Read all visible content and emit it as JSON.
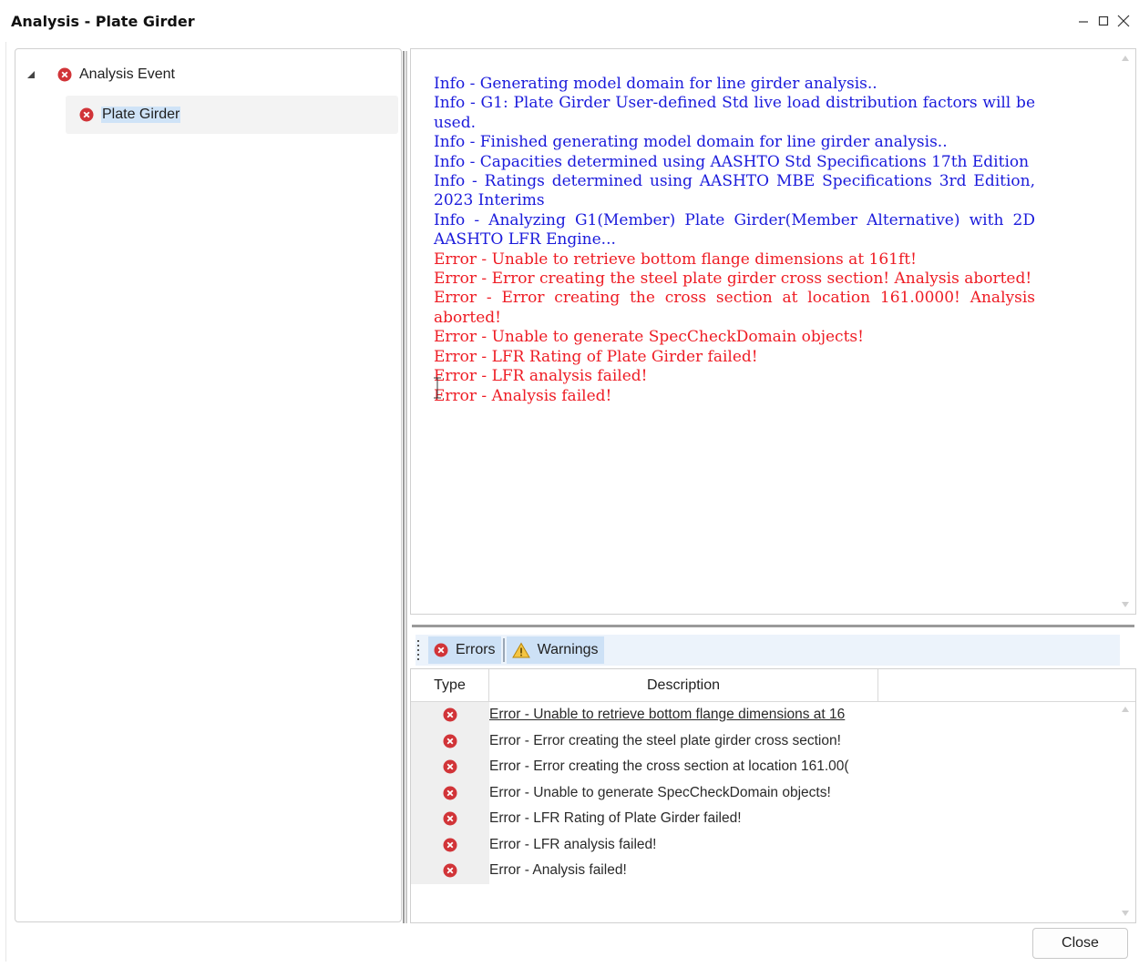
{
  "window": {
    "title": "Analysis - Plate Girder",
    "controls": [
      "minimize",
      "maximize",
      "close"
    ]
  },
  "tree": {
    "root": {
      "label": "Analysis Event",
      "icon": "error-icon",
      "expanded": true
    },
    "children": [
      {
        "label": "Plate Girder",
        "icon": "error-icon",
        "selected": true
      }
    ]
  },
  "log": {
    "lines": [
      {
        "kind": "info",
        "text": "Info - Generating model domain for line girder analysis.."
      },
      {
        "kind": "info",
        "text": "Info - G1: Plate Girder User-defined Std live load distribution factors will be used."
      },
      {
        "kind": "info",
        "text": "Info - Finished generating model domain for line girder analysis.."
      },
      {
        "kind": "info",
        "text": "Info - Capacities determined using AASHTO Std Specifications 17th Edition"
      },
      {
        "kind": "info",
        "text": "Info - Ratings determined using AASHTO MBE Specifications 3rd Edition, 2023 Interims"
      },
      {
        "kind": "info",
        "text": "Info - Analyzing G1(Member) Plate Girder(Member Alternative) with 2D AASHTO LFR Engine..."
      },
      {
        "kind": "error",
        "text": "Error - Unable to retrieve bottom flange dimensions at 161ft!"
      },
      {
        "kind": "error",
        "text": "Error - Error creating the steel plate girder cross section! Analysis aborted!"
      },
      {
        "kind": "error",
        "text": "Error - Error creating the cross section at location 161.0000! Analysis aborted!"
      },
      {
        "kind": "error",
        "text": "Error - Unable to generate SpecCheckDomain objects!"
      },
      {
        "kind": "error",
        "text": "Error - LFR Rating of Plate Girder failed!"
      },
      {
        "kind": "error",
        "text": "Error - LFR analysis failed!"
      },
      {
        "kind": "error",
        "text": "Error - Analysis failed!"
      }
    ],
    "colors": {
      "info": "#1a1adb",
      "error": "#ee1c24"
    }
  },
  "tabs": {
    "errors_label": "Errors",
    "warnings_label": "Warnings",
    "active": "errors"
  },
  "table": {
    "columns": [
      "Type",
      "Description"
    ],
    "rows": [
      {
        "type": "error-icon",
        "description": "Error - Unable to retrieve bottom flange dimensions at 16"
      },
      {
        "type": "error-icon",
        "description": "Error - Error creating the steel plate girder cross section!"
      },
      {
        "type": "error-icon",
        "description": "Error - Error creating the cross section at location 161.00("
      },
      {
        "type": "error-icon",
        "description": "Error - Unable to generate SpecCheckDomain objects!"
      },
      {
        "type": "error-icon",
        "description": "Error - LFR Rating of Plate Girder failed!"
      },
      {
        "type": "error-icon",
        "description": "Error - LFR analysis failed!"
      },
      {
        "type": "error-icon",
        "description": "Error - Analysis failed!"
      }
    ]
  },
  "footer": {
    "close_label": "Close"
  }
}
